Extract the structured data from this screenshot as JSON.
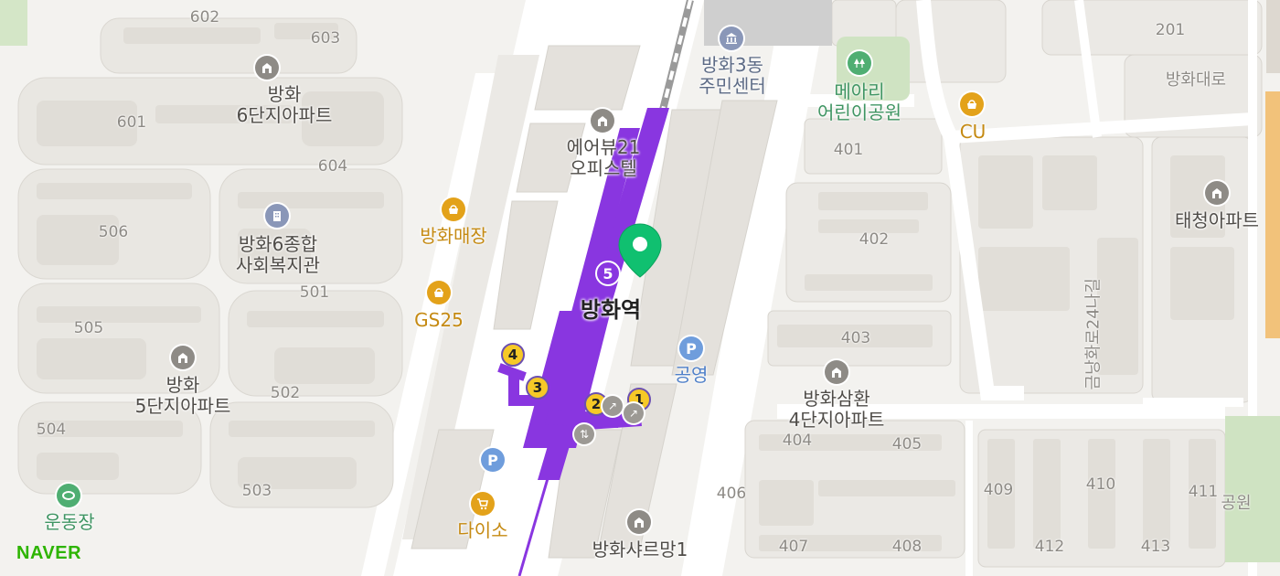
{
  "map": {
    "brand": "NAVER",
    "colors": {
      "background": "#f3f2ef",
      "road": "#ffffff",
      "block": "#ebe9e5",
      "building": "#e2dfda",
      "metro_line5": "#8936e0",
      "park": "#cfe3c2",
      "marker": "#10c070",
      "brand": "#2db400"
    },
    "station": {
      "name": "방화역",
      "line_badge": "5",
      "exits": [
        "1",
        "2",
        "3",
        "4"
      ]
    },
    "pois": [
      {
        "name": "방화\n6단지아파트",
        "icon": "apartment-icon"
      },
      {
        "name": "방화6종합\n사회복지관",
        "icon": "welfare-center-icon"
      },
      {
        "name": "방화\n5단지아파트",
        "icon": "apartment-icon"
      },
      {
        "name": "운동장",
        "icon": "stadium-icon"
      },
      {
        "name": "방화매장",
        "icon": "store-icon"
      },
      {
        "name": "GS25",
        "icon": "convenience-store-icon"
      },
      {
        "name": "다이소",
        "icon": "shopping-cart-icon"
      },
      {
        "name": "에어뷰21\n오피스텔",
        "icon": "building-icon"
      },
      {
        "name": "방화3동\n주민센터",
        "icon": "government-icon"
      },
      {
        "name": "메아리\n어린이공원",
        "icon": "park-tree-icon"
      },
      {
        "name": "CU",
        "icon": "convenience-store-icon"
      },
      {
        "name": "태청아파트",
        "icon": "apartment-icon"
      },
      {
        "name": "공영",
        "icon": "parking-icon"
      },
      {
        "name": "방화삼환\n4단지아파트",
        "icon": "apartment-icon"
      },
      {
        "name": "방화샤르망1",
        "icon": "apartment-icon"
      }
    ],
    "parking_label": "P",
    "building_numbers": [
      "602",
      "603",
      "601",
      "604",
      "506",
      "501",
      "505",
      "502",
      "504",
      "503",
      "201",
      "401",
      "402",
      "403",
      "404",
      "405",
      "406",
      "407",
      "408",
      "409",
      "410",
      "411",
      "412",
      "413"
    ],
    "roads": [
      "방화대로",
      "금낭화로24나길"
    ],
    "misc": [
      "공원"
    ]
  }
}
